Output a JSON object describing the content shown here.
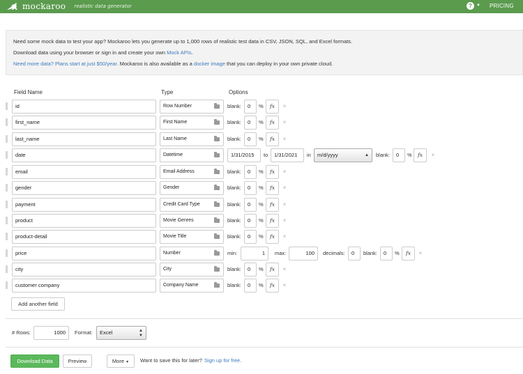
{
  "header": {
    "logo_text": "mockaroo",
    "tagline": "realistic data generator",
    "help_icon": "?",
    "pricing_label": "PRICING"
  },
  "intro": {
    "line1": "Need some mock data to test your app? Mockaroo lets you generate up to 1,000 rows of realistic test data in CSV, JSON, SQL, and Excel formats.",
    "line2_prefix": "Download data using your browser or sign in and create your own ",
    "line2_link": "Mock APIs",
    "line2_suffix": ".",
    "line3_link": "Need more data? Plans start at just $50/year.",
    "line3_mid": " Mockaroo is also available as a ",
    "line3_link2": "docker image",
    "line3_suffix": " that you can deploy in your own private cloud."
  },
  "columns": {
    "field_name": "Field Name",
    "type": "Type",
    "options": "Options"
  },
  "fields": {
    "f0": {
      "name": "id",
      "type": "Row Number",
      "blank": "0"
    },
    "f1": {
      "name": "first_name",
      "type": "First Name",
      "blank": "0"
    },
    "f2": {
      "name": "last_name",
      "type": "Last Name",
      "blank": "0"
    },
    "f3": {
      "name": "date",
      "type": "Datetime",
      "from": "1/31/2015",
      "to_label": "to",
      "to": "1/31/2021",
      "in_label": "in",
      "format": "m/d/yyyy",
      "blank": "0"
    },
    "f4": {
      "name": "email",
      "type": "Email Address",
      "blank": "0"
    },
    "f5": {
      "name": "gender",
      "type": "Gender",
      "blank": "0"
    },
    "f6": {
      "name": "payment",
      "type": "Credit Card Type",
      "blank": "0"
    },
    "f7": {
      "name": "product",
      "type": "Movie Genres",
      "blank": "0"
    },
    "f8": {
      "name": "product-detail",
      "type": "Movie Title",
      "blank": "0"
    },
    "f9": {
      "name": "price",
      "type": "Number",
      "min_label": "min:",
      "min": "1",
      "max_label": "max:",
      "max": "100",
      "decimals_label": "decimals:",
      "decimals": "0",
      "blank": "0"
    },
    "f10": {
      "name": "city",
      "type": "City",
      "blank": "0"
    },
    "f11": {
      "name": "customer company",
      "type": "Company Name",
      "blank": "0"
    }
  },
  "common": {
    "blank_label": "blank:",
    "percent": "%",
    "fx": "fx",
    "delete": "×"
  },
  "add_field_label": "Add another field",
  "settings": {
    "rows_label": "# Rows:",
    "rows": "1000",
    "format_label": "Format:",
    "format": "Excel"
  },
  "actions": {
    "download": "Download Data",
    "preview": "Preview",
    "more": "More",
    "save_text": "Want to save this for later?",
    "signup": "Sign up for free."
  }
}
